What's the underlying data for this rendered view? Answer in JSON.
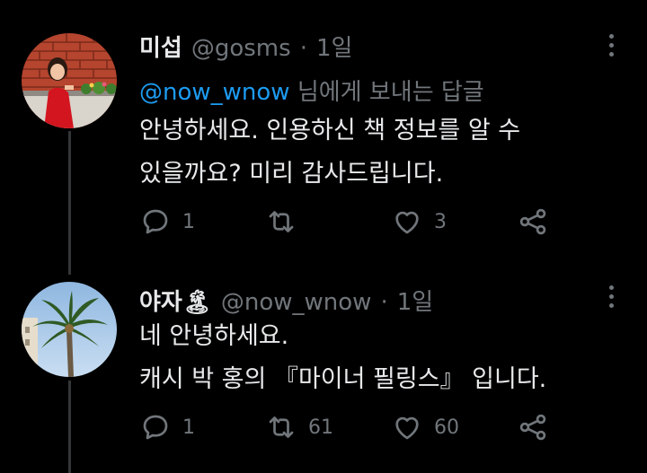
{
  "tweets": [
    {
      "name": "미섭",
      "name_emoji": "",
      "handle": "@gosms",
      "dot": "·",
      "time": "1일",
      "reply_to_mention": "@now_wnow",
      "reply_to_suffix": " 님에게 보내는 답글",
      "lines": [
        "안녕하세요. 인용하신 책 정보를 알 수",
        "있을까요? 미리 감사드립니다."
      ],
      "replies": "1",
      "retweets": "",
      "likes": "3",
      "icons": [
        "reply-icon",
        "retweet-icon",
        "like-icon",
        "share-icon",
        "more-icon"
      ]
    },
    {
      "name": "야자",
      "name_emoji": "🏝",
      "handle": "@now_wnow",
      "dot": "·",
      "time": "1일",
      "lines": [
        "네 안녕하세요.",
        "캐시 박 홍의 『마이너 필링스』 입니다."
      ],
      "replies": "1",
      "retweets": "61",
      "likes": "60",
      "icons": [
        "reply-icon",
        "retweet-icon",
        "like-icon",
        "share-icon",
        "more-icon"
      ]
    }
  ],
  "colors": {
    "background": "#000000",
    "text": "#e7e9ea",
    "muted": "#71767b",
    "link": "#1d9bf0",
    "thread_line": "#333639"
  }
}
